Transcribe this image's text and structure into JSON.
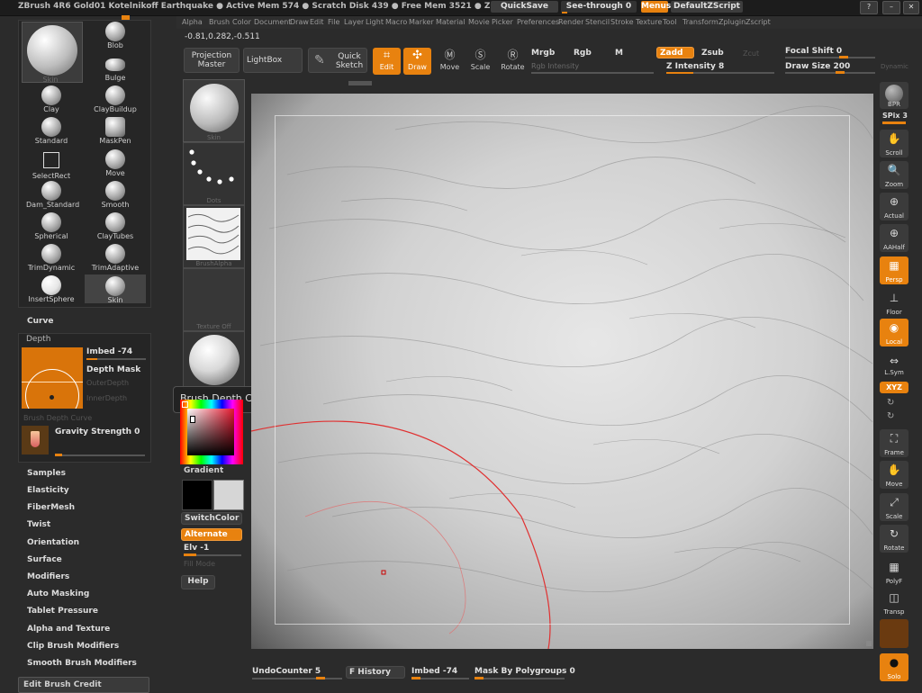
{
  "titlebar": {
    "title": "ZBrush 4R6 Gold01   Kotelnikoff Earthquake  ● Active Mem 574 ● Scratch Disk 439 ● Free Mem 3521 ● Z",
    "quicksave": "QuickSave",
    "see_through": "See-through  0",
    "menus": "Menus",
    "default_zscript": "DefaultZScript"
  },
  "menubar": [
    "Alpha",
    "Brush",
    "Color",
    "Document",
    "Draw",
    "Edit",
    "File",
    "Layer",
    "Light",
    "Macro",
    "Marker",
    "Material",
    "Movie",
    "Picker",
    "Preferences",
    "Render",
    "Stencil",
    "Stroke",
    "Texture",
    "Tool",
    "Transform",
    "Zplugin",
    "Zscript"
  ],
  "coords": "-0.81,0.282,-0.511",
  "top_shelf": {
    "projection_master": "Projection Master",
    "lightbox": "LightBox",
    "quick_sketch": "Quick Sketch",
    "edit": "Edit",
    "draw": "Draw",
    "move": "Move",
    "scale": "Scale",
    "rotate": "Rotate",
    "mrgb": "Mrgb",
    "rgb": "Rgb",
    "m": "M",
    "rgb_intensity": "Rgb Intensity",
    "zadd": "Zadd",
    "zsub": "Zsub",
    "zcut": "Zcut",
    "z_intensity": "Z Intensity 8",
    "focal_shift": "Focal Shift 0",
    "draw_size": "Draw Size 200",
    "dynamic": "Dynamic"
  },
  "brushes": [
    {
      "name": "Skin"
    },
    {
      "name": "Blob"
    },
    {
      "name": "Bulge"
    },
    {
      "name": "Clay"
    },
    {
      "name": "ClayBuildup"
    },
    {
      "name": "Standard"
    },
    {
      "name": "MaskPen"
    },
    {
      "name": "SelectRect"
    },
    {
      "name": "Move"
    },
    {
      "name": "Dam_Standard"
    },
    {
      "name": "Smooth"
    },
    {
      "name": "Spherical"
    },
    {
      "name": "ClayTubes"
    },
    {
      "name": "TrimDynamic"
    },
    {
      "name": "TrimAdaptive"
    },
    {
      "name": "InsertSphere"
    },
    {
      "name": "Skin"
    }
  ],
  "brush_palette": {
    "curve": "Curve",
    "depth": "Depth",
    "imbed": "Imbed -74",
    "depth_mask": "Depth Mask",
    "outer_depth": "OuterDepth",
    "inner_depth": "InnerDepth",
    "brush_depth_curve": "Brush Depth Curve",
    "gravity_strength": "Gravity Strength 0",
    "sections": [
      "Samples",
      "Elasticity",
      "FiberMesh",
      "Twist",
      "Orientation",
      "Surface",
      "Modifiers",
      "Auto Masking",
      "Tablet Pressure",
      "Alpha and Texture",
      "Clip Brush Modifiers",
      "Smooth Brush Modifiers"
    ],
    "edit_brush_credit": "Edit Brush Credit"
  },
  "left_shelf": {
    "brush_label": "Skin",
    "stroke_label": "Dots",
    "alpha_label": "BrushAlpha",
    "texture_label": "Texture Off",
    "gradient": "Gradient",
    "switch_color": "SwitchColor",
    "alternate": "Alternate",
    "elv": "Elv -1",
    "fill_mode": "Fill Mode",
    "help": "Help"
  },
  "tooltip": "Brush Depth Curve",
  "right_shelf": [
    {
      "name": "bpr",
      "label": "BPR",
      "icon": "●"
    },
    {
      "name": "spix",
      "label": "SPix 3",
      "icon": ""
    },
    {
      "name": "scroll",
      "label": "Scroll",
      "icon": "✋"
    },
    {
      "name": "zoom",
      "label": "Zoom",
      "icon": "🔍"
    },
    {
      "name": "actual",
      "label": "Actual",
      "icon": "⊕"
    },
    {
      "name": "aahalf",
      "label": "AAHalf",
      "icon": "⊕"
    },
    {
      "name": "persp",
      "label": "Persp",
      "icon": "▦"
    },
    {
      "name": "floor",
      "label": "Floor",
      "icon": "⊥"
    },
    {
      "name": "local",
      "label": "Local",
      "icon": "◉"
    },
    {
      "name": "lsym",
      "label": "L.Sym",
      "icon": "⇔"
    },
    {
      "name": "xyz",
      "label": "XYZ",
      "icon": ""
    },
    {
      "name": "frame",
      "label": "Frame",
      "icon": "⛶"
    },
    {
      "name": "move",
      "label": "Move",
      "icon": "✋"
    },
    {
      "name": "scale",
      "label": "Scale",
      "icon": "⤢"
    },
    {
      "name": "rotate",
      "label": "Rotate",
      "icon": "↻"
    },
    {
      "name": "polyf",
      "label": "PolyF",
      "icon": "▦"
    },
    {
      "name": "transp",
      "label": "Transp",
      "icon": "◫"
    },
    {
      "name": "solo",
      "label": "Solo",
      "icon": "●"
    }
  ],
  "bottombar": {
    "undo_counter": "UndoCounter 5",
    "history": "F History",
    "imbed": "Imbed -74",
    "mask_by_polygroups": "Mask By Polygroups 0"
  },
  "colors": {
    "accent": "#e8820f",
    "panel": "#2b2b2b",
    "canvas": "#d4d4d4"
  }
}
